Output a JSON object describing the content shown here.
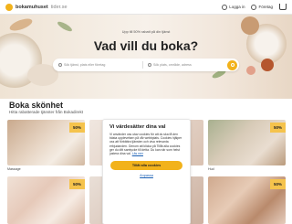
{
  "header": {
    "logo_brand": "bokamuhuset",
    "logo_domain": "tider.se",
    "links": [
      {
        "label": "Logga in",
        "icon": "user-icon"
      },
      {
        "label": "Företag",
        "icon": "building-icon"
      }
    ],
    "cart_icon": "cart-icon"
  },
  "hero": {
    "small_text": "Upp till 50% rabatt på din tjänst",
    "title": "Vad vill du boka?",
    "search": {
      "what_placeholder": "Sök tjänst, plats eller företag",
      "where_placeholder": "Sök plats, område, adress",
      "button_icon": "search-icon"
    }
  },
  "section": {
    "title": "Boka skönhet",
    "subtitle": "Hitta rabatterade tjänster från Bokadirekt"
  },
  "cards": [
    {
      "badge": "50%",
      "label": "Massage"
    },
    {
      "badge": "50%",
      "label": "Hud"
    },
    {
      "badge": "50%",
      "label": ""
    },
    {
      "badge": "50%",
      "label": ""
    }
  ],
  "cookie_modal": {
    "title": "Vi värdesätter dina val",
    "text": "Vi använder oss utav cookies för att du ska få den bästa upplevelsen på vår webbplats. Cookies hjälper oss att förbättra tjänsten och visa relevanta erbjudanden. Genom att klicka på Tillåt alla cookies ger du ditt samtycke till detta. Du kan när som helst justera dina val.",
    "link_text": "Läs mer",
    "accept_label": "Tillåt alla cookies",
    "adjust_label": "Anpassa"
  },
  "colors": {
    "accent": "#f2b21b",
    "badge": "#f5c34c",
    "link": "#1a5fb4"
  }
}
